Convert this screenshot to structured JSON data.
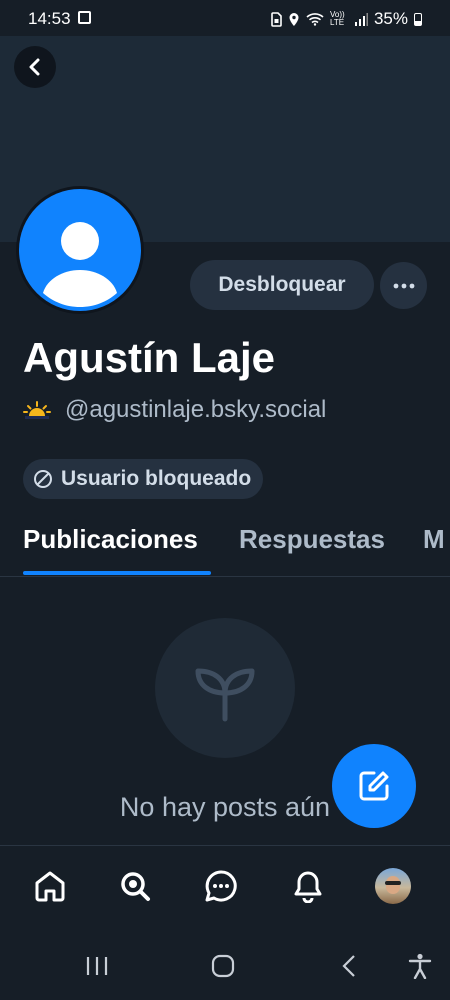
{
  "status_bar": {
    "time": "14:53",
    "battery": "35%",
    "icons": [
      "gallery-icon",
      "sim-icon",
      "location-icon",
      "wifi-icon",
      "volte-icon",
      "signal-icon",
      "battery-icon"
    ],
    "volte_label": "Vo)) LTE"
  },
  "profile": {
    "display_name": "Agustín Laje",
    "handle": "@agustinlaje.bsky.social",
    "handle_emoji": "🌅",
    "blocked_label": "Usuario bloqueado",
    "unblock_label": "Desbloquear"
  },
  "tabs": [
    {
      "label": "Publicaciones",
      "active": true
    },
    {
      "label": "Respuestas",
      "active": false
    },
    {
      "label": "M",
      "active": false
    }
  ],
  "feed": {
    "empty_text": "No hay posts aún"
  },
  "bottom_nav": [
    "home-icon",
    "search-icon",
    "chat-icon",
    "bell-icon",
    "profile-avatar"
  ],
  "system_nav": [
    "recents-icon",
    "home-circle-icon",
    "back-chevron-icon",
    "accessibility-icon"
  ],
  "colors": {
    "background": "#161e27",
    "banner": "#1d2a37",
    "accent": "#1083fe",
    "chip": "#253140",
    "muted_text": "#aebbc9"
  }
}
